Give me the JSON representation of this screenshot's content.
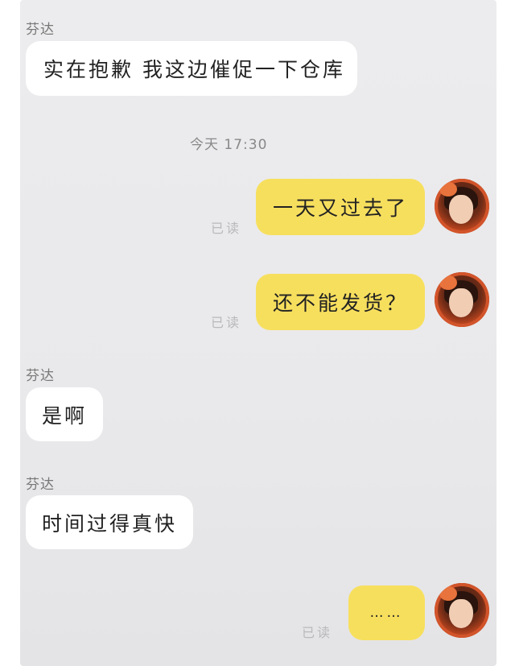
{
  "chat": {
    "messages": [
      {
        "sender": "芬达",
        "text": "实在抱歉 我这边催促一下仓库"
      },
      {
        "text": "一天又过去了",
        "status": "已读"
      },
      {
        "text": "还不能发货？",
        "status": "已读"
      },
      {
        "sender": "芬达",
        "text": "是啊"
      },
      {
        "sender": "芬达",
        "text": "时间过得真快"
      },
      {
        "text": "……",
        "status": "已读"
      }
    ],
    "timestamp": "今天 17:30"
  },
  "colors": {
    "background": "#ececee",
    "incoming_bubble": "#ffffff",
    "outgoing_bubble": "#f7df5e"
  },
  "icons": {
    "avatar": "user-avatar"
  }
}
